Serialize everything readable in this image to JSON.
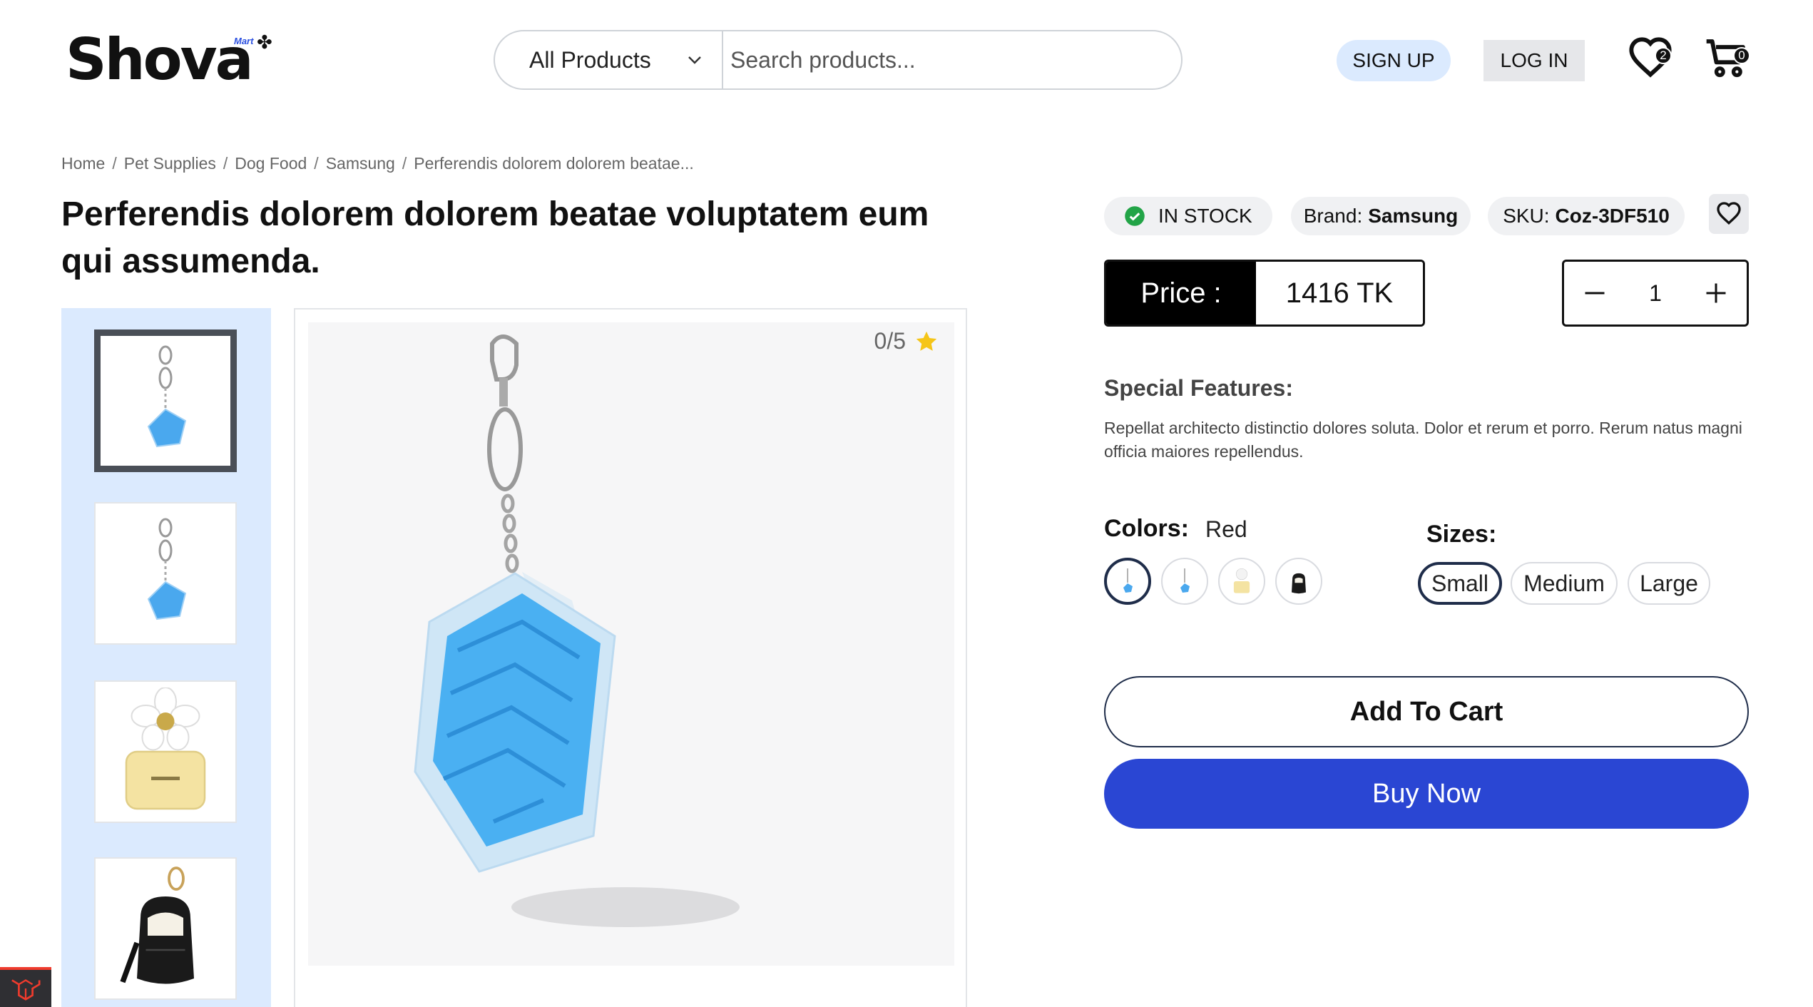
{
  "header": {
    "logo_text": "Shova",
    "logo_tag": "Mart",
    "category_selected": "All Products",
    "search_placeholder": "Search products...",
    "signup_label": "SIGN UP",
    "login_label": "LOG IN",
    "wishlist_count": "2",
    "cart_count": "0"
  },
  "breadcrumb": [
    "Home",
    "Pet Supplies",
    "Dog Food",
    "Samsung",
    "Perferendis dolorem dolorem beatae..."
  ],
  "product": {
    "title": "Perferendis dolorem dolorem beatae voluptatem eum qui assumenda.",
    "rating": "0/5",
    "stock_status": "IN STOCK",
    "brand_label": "Brand:",
    "brand_value": "Samsung",
    "sku_label": "SKU:",
    "sku_value": "Coz-3DF510",
    "price_label": "Price :",
    "price_value": "1416 TK",
    "quantity": "1",
    "special_features_title": "Special Features:",
    "special_features_text": "Repellat architecto distinctio dolores soluta. Dolor et rerum et porro. Rerum natus magni officia maiores repellendus.",
    "colors_label": "Colors:",
    "selected_color": "Red",
    "sizes_label": "Sizes:",
    "sizes": [
      "Small",
      "Medium",
      "Large"
    ],
    "selected_size": "Small",
    "add_to_cart_label": "Add To Cart",
    "buy_now_label": "Buy Now"
  },
  "gallery": {
    "thumbnails": [
      "maze-cube-keychain-icon",
      "maze-cube-keychain-icon",
      "daisy-perfume-icon",
      "mini-backpack-keychain-icon"
    ],
    "active_index": 0
  },
  "colors": {
    "brand_blue": "#2a46d3",
    "light_blue": "#dbeafe",
    "stock_green": "#22a447",
    "star": "#f5c518"
  }
}
